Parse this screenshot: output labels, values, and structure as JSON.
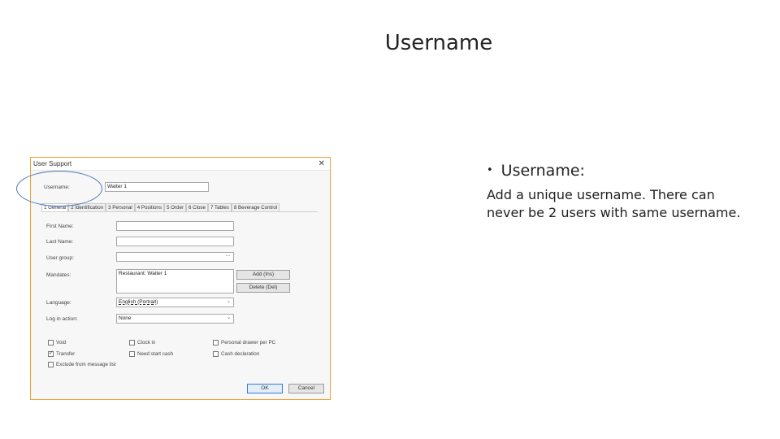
{
  "slide": {
    "title": "Username",
    "bullet_label": "Username:",
    "body": "Add a unique username. There can never be 2 users with same username."
  },
  "dialog": {
    "title": "User Support",
    "close_glyph": "✕",
    "username_label": "Username:",
    "username_value": "Waiter 1",
    "tabs": [
      "1 General",
      "2 Identification",
      "3 Personal",
      "4 Positions",
      "5 Order",
      "6 Close",
      "7 Tables",
      "8 Beverage Control"
    ],
    "fields": {
      "first_name_label": "First Name:",
      "last_name_label": "Last Name:",
      "user_group_label": "User group:",
      "user_group_button": "...",
      "mandates_label": "Mandates:",
      "mandates_value": "Restaurant: Waiter 1",
      "language_label": "Language:",
      "language_value": "English (Portrait)",
      "login_action_label": "Log in action:",
      "login_action_value": "None"
    },
    "buttons": {
      "add": "Add (Ins)",
      "delete": "Delete (Del)",
      "ok": "OK",
      "cancel": "Cancel"
    },
    "checkboxes": [
      {
        "label": "Void",
        "checked": false
      },
      {
        "label": "Clock in",
        "checked": false
      },
      {
        "label": "Personal drawer per PC",
        "checked": false
      },
      {
        "label": "Transfer",
        "checked": true
      },
      {
        "label": "Need start cash",
        "checked": false
      },
      {
        "label": "Cash declaration",
        "checked": false
      },
      {
        "label": "Exclude from message list",
        "checked": false
      }
    ],
    "chevron_glyph": "⌄"
  },
  "colors": {
    "dialog_border": "#f0a030",
    "highlight_oval": "#4a78b8"
  }
}
